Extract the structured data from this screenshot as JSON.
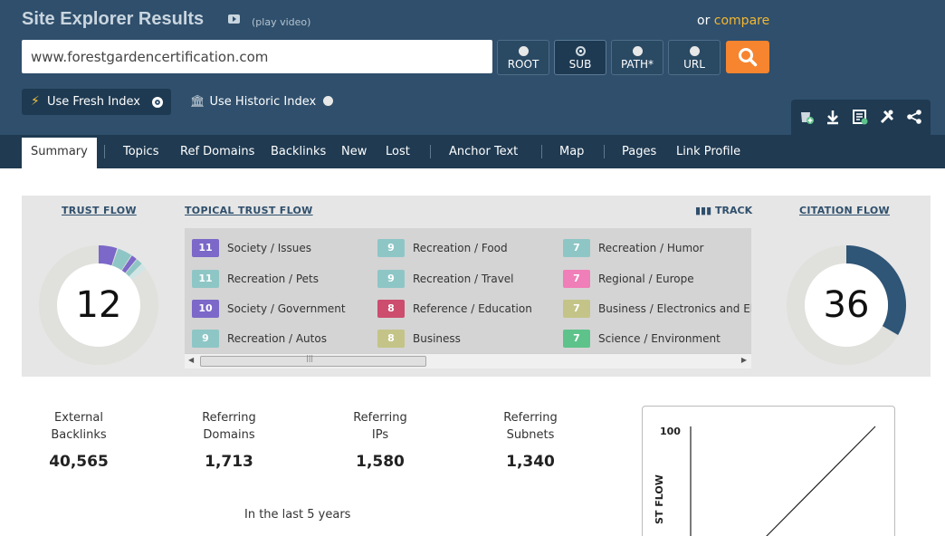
{
  "header": {
    "title": "Site Explorer Results",
    "play_video": "(play video)",
    "or_text": "or",
    "compare_link": "compare",
    "url_value": "www.forestgardencertification.com",
    "modes": [
      {
        "label": "ROOT",
        "selected": false
      },
      {
        "label": "SUB",
        "selected": true
      },
      {
        "label": "PATH*",
        "selected": false
      },
      {
        "label": "URL",
        "selected": false
      }
    ],
    "fresh_index": "Use Fresh Index",
    "historic_index": "Use Historic Index",
    "tool_icons": [
      "add-to-bucket-icon",
      "download-icon",
      "report-icon",
      "tools-icon",
      "share-icon"
    ]
  },
  "nav": {
    "tabs": [
      "Summary",
      "Topics",
      "Ref Domains",
      "Backlinks",
      "New",
      "Lost",
      "Anchor Text",
      "Map",
      "Pages",
      "Link Profile"
    ],
    "active": "Summary"
  },
  "panel": {
    "trust_flow_label": "TRUST FLOW",
    "trust_flow_value": "12",
    "topical_label": "TOPICAL TRUST FLOW",
    "track_label": "TRACK",
    "citation_flow_label": "CITATION FLOW",
    "citation_flow_value": "36",
    "topics": [
      {
        "value": "11",
        "name": "Society / Issues",
        "color": "#7b68c8"
      },
      {
        "value": "9",
        "name": "Recreation / Food",
        "color": "#8ec6c6"
      },
      {
        "value": "7",
        "name": "Recreation / Humor",
        "color": "#8ec6c6"
      },
      {
        "value": "11",
        "name": "Recreation / Pets",
        "color": "#8ec6c6"
      },
      {
        "value": "9",
        "name": "Recreation / Travel",
        "color": "#8ec6c6"
      },
      {
        "value": "7",
        "name": "Regional / Europe",
        "color": "#f07eb8"
      },
      {
        "value": "10",
        "name": "Society / Government",
        "color": "#7b68c8"
      },
      {
        "value": "8",
        "name": "Reference / Education",
        "color": "#cc4d6e"
      },
      {
        "value": "7",
        "name": "Business / Electronics and Ele",
        "color": "#c4c488"
      },
      {
        "value": "9",
        "name": "Recreation / Autos",
        "color": "#8ec6c6"
      },
      {
        "value": "8",
        "name": "Business",
        "color": "#c4c488"
      },
      {
        "value": "7",
        "name": "Science / Environment",
        "color": "#5ec38a"
      }
    ]
  },
  "stats": [
    {
      "label_line1": "External",
      "label_line2": "Backlinks",
      "value": "40,565"
    },
    {
      "label_line1": "Referring",
      "label_line2": "Domains",
      "value": "1,713"
    },
    {
      "label_line1": "Referring",
      "label_line2": "IPs",
      "value": "1,580"
    },
    {
      "label_line1": "Referring",
      "label_line2": "Subnets",
      "value": "1,340"
    }
  ],
  "period": "In the last 5 years",
  "flow_chart": {
    "y_max_label": "100",
    "y_axis_label": "ST FLOW"
  }
}
